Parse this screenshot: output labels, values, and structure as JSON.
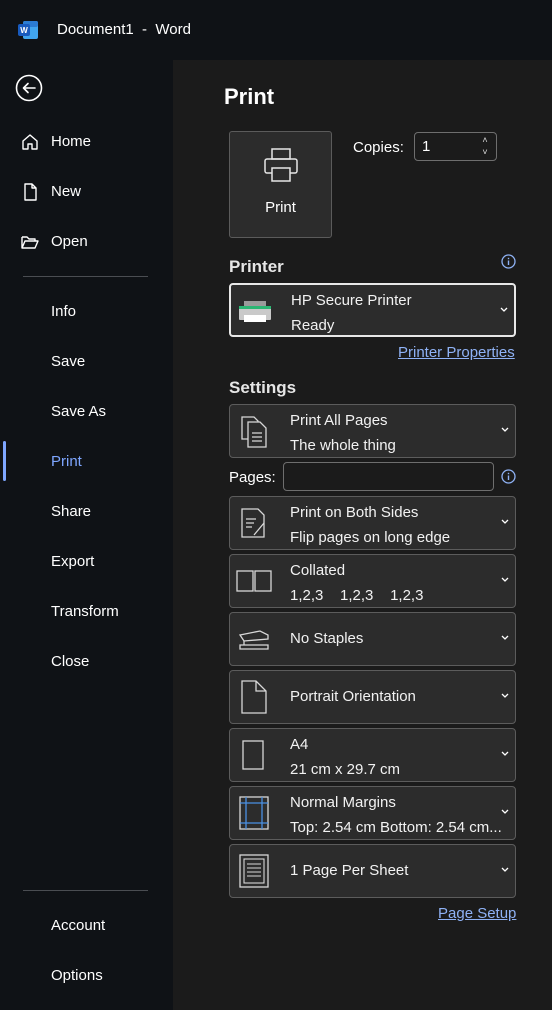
{
  "titlebar": {
    "title": "Document1  -  Word"
  },
  "nav": {
    "items": [
      {
        "label": "Home"
      },
      {
        "label": "New"
      },
      {
        "label": "Open"
      },
      {
        "label": "Info"
      },
      {
        "label": "Save"
      },
      {
        "label": "Save As"
      },
      {
        "label": "Print"
      },
      {
        "label": "Share"
      },
      {
        "label": "Export"
      },
      {
        "label": "Transform"
      },
      {
        "label": "Close"
      },
      {
        "label": "Account"
      },
      {
        "label": "Options"
      }
    ],
    "active": "Print"
  },
  "main": {
    "title": "Print",
    "print_button": "Print",
    "copies": {
      "label": "Copies:",
      "value": "1"
    },
    "printer": {
      "heading": "Printer",
      "name": "HP Secure Printer",
      "status": "Ready",
      "properties_link": "Printer Properties"
    },
    "settings": {
      "heading": "Settings",
      "pages_label": "Pages:",
      "pages_value": "",
      "options": [
        {
          "line1": "Print All Pages",
          "line2": "The whole thing",
          "icon": "pages-icon"
        },
        {
          "line1": "Print on Both Sides",
          "line2": "Flip pages on long edge",
          "icon": "duplex-icon"
        },
        {
          "line1": "Collated",
          "line2": "1,2,3    1,2,3    1,2,3",
          "icon": "collate-icon"
        },
        {
          "line1": "No Staples",
          "line2": "",
          "icon": "stapler-icon"
        },
        {
          "line1": "Portrait Orientation",
          "line2": "",
          "icon": "portrait-icon"
        },
        {
          "line1": "A4",
          "line2": "21 cm x 29.7 cm",
          "icon": "paper-size-icon"
        },
        {
          "line1": "Normal Margins",
          "line2": "Top: 2.54 cm Bottom: 2.54 cm...",
          "icon": "margins-icon"
        },
        {
          "line1": "1 Page Per Sheet",
          "line2": "",
          "icon": "pages-per-sheet-icon"
        }
      ],
      "page_setup_link": "Page Setup"
    }
  },
  "colors": {
    "accent": "#7ea6ff",
    "link": "#8fb2f5",
    "panel": "#1b1b1b",
    "nav_bg": "#0f1216"
  }
}
